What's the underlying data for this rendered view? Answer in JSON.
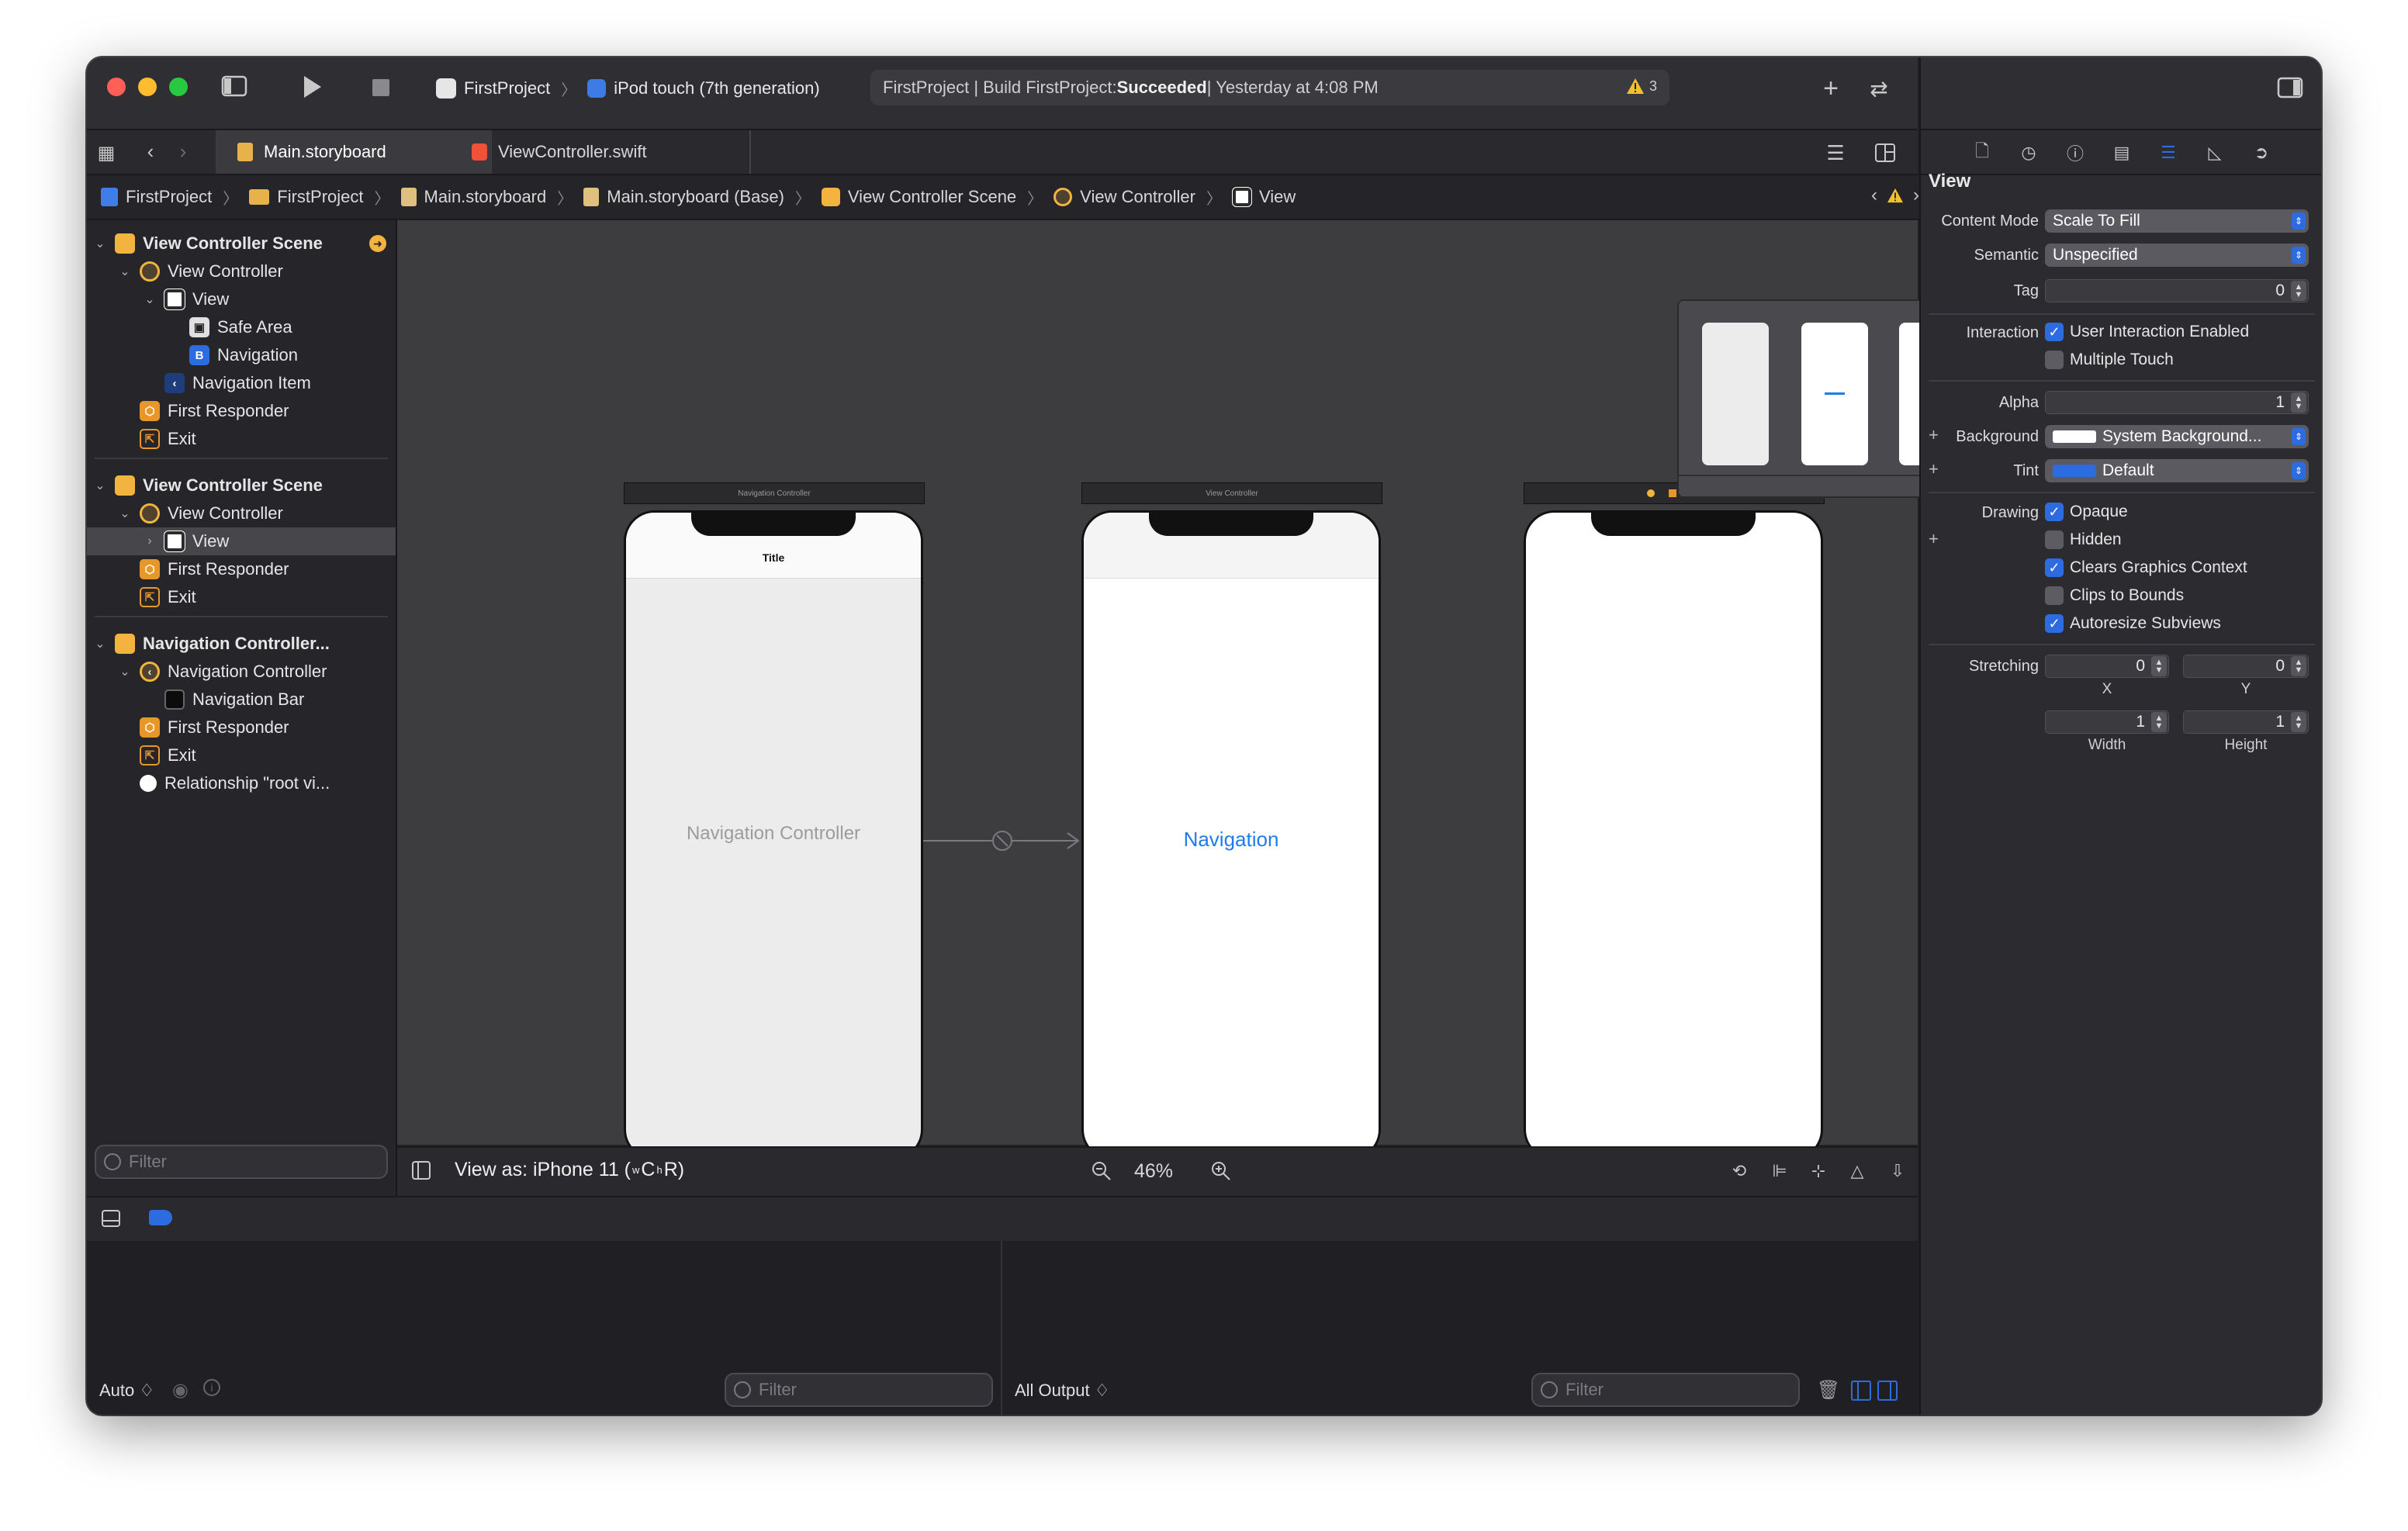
{
  "titlebar": {
    "scheme_name": "FirstProject",
    "device_name": "iPod touch (7th generation)",
    "status_prefix": "FirstProject | Build FirstProject: ",
    "status_result": "Succeeded",
    "status_time": " | Yesterday at 4:08 PM",
    "warning_count": "3"
  },
  "tabs": [
    {
      "label": "Main.storyboard"
    },
    {
      "label": "ViewController.swift"
    }
  ],
  "breadcrumb": [
    {
      "label": "FirstProject"
    },
    {
      "label": "FirstProject"
    },
    {
      "label": "Main.storyboard"
    },
    {
      "label": "Main.storyboard (Base)"
    },
    {
      "label": "View Controller Scene"
    },
    {
      "label": "View Controller"
    },
    {
      "label": "View"
    }
  ],
  "outline": [
    {
      "label": "View Controller Scene"
    },
    {
      "label": "View Controller"
    },
    {
      "label": "View"
    },
    {
      "label": "Safe Area"
    },
    {
      "label": "Navigation"
    },
    {
      "label": "Navigation Item"
    },
    {
      "label": "First Responder"
    },
    {
      "label": "Exit"
    },
    {
      "label": "View Controller Scene"
    },
    {
      "label": "View Controller"
    },
    {
      "label": "View"
    },
    {
      "label": "First Responder"
    },
    {
      "label": "Exit"
    },
    {
      "label": "Navigation Controller..."
    },
    {
      "label": "Navigation Controller"
    },
    {
      "label": "Navigation Bar"
    },
    {
      "label": "First Responder"
    },
    {
      "label": "Exit"
    },
    {
      "label": "Relationship \"root vi..."
    }
  ],
  "navigator": {
    "filter_placeholder": "Filter"
  },
  "canvas": {
    "scene1_header": "Navigation Controller",
    "scene1_title": "Title",
    "scene1_body": "Navigation Controller",
    "scene2_header": "View Controller",
    "scene2_body": "Navigation",
    "view_as": "View as: iPhone 11 (",
    "view_as_w": "w",
    "view_as_c": "C ",
    "view_as_h": "h",
    "view_as_r": "R)",
    "zoom": "46%"
  },
  "debug": {
    "auto_label": "Auto ♢",
    "filter_placeholder": "Filter",
    "output_label": "All Output ♢",
    "filter2_placeholder": "Filter"
  },
  "inspector": {
    "section_title": "View",
    "content_mode_label": "Content Mode",
    "content_mode_value": "Scale To Fill",
    "semantic_label": "Semantic",
    "semantic_value": "Unspecified",
    "tag_label": "Tag",
    "tag_value": "0",
    "interaction_label": "Interaction",
    "user_interaction": "User Interaction Enabled",
    "multiple_touch": "Multiple Touch",
    "alpha_label": "Alpha",
    "alpha_value": "1",
    "background_label": "Background",
    "background_value": "System Background...",
    "tint_label": "Tint",
    "tint_value": "Default",
    "drawing_label": "Drawing",
    "opaque": "Opaque",
    "hidden": "Hidden",
    "clears_graphics": "Clears Graphics Context",
    "clips_bounds": "Clips to Bounds",
    "autoresize": "Autoresize Subviews",
    "stretching_label": "Stretching",
    "stretch_x_value": "0",
    "stretch_y_value": "0",
    "stretch_w_value": "1",
    "stretch_h_value": "1",
    "x_caption": "X",
    "y_caption": "Y",
    "width_caption": "Width",
    "height_caption": "Height"
  },
  "colors": {
    "accent": "#2d6be0",
    "scene_icon": "#f3b43f",
    "responder_icon": "#e7972a",
    "traffic_close": "#ff5f57",
    "traffic_min": "#febc2e",
    "traffic_max": "#28c840",
    "nav_link": "#1f7cea"
  },
  "icons": [
    "sidebar-toggle-icon",
    "run-icon",
    "stop-icon",
    "warning-icon",
    "add-icon",
    "swap-icon",
    "grid-icon",
    "back-icon",
    "forward-icon",
    "storyboard-icon",
    "swift-icon",
    "lines-icon",
    "split-icon",
    "file-icon",
    "history-icon",
    "help-icon",
    "identity-icon",
    "attributes-icon",
    "size-icon",
    "connections-icon",
    "filter-icon",
    "zoom-out-icon",
    "zoom-in-icon",
    "trash-icon"
  ]
}
